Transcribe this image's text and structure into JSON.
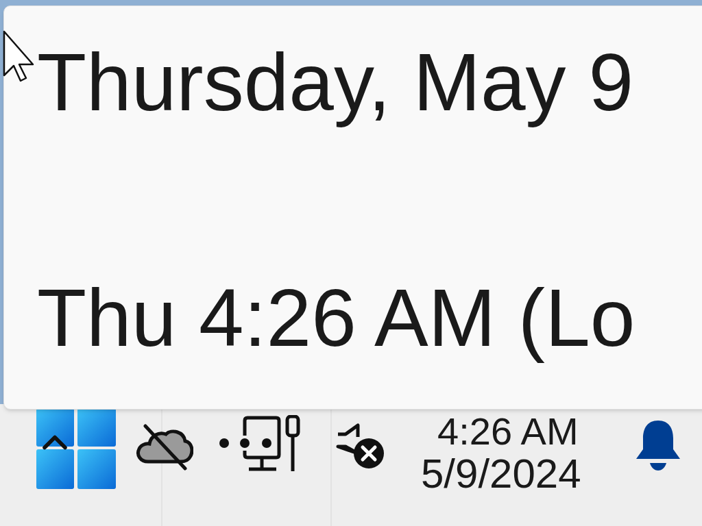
{
  "tooltip": {
    "lines": [
      "Thursday, May 9",
      "Thu 4:26 AM (Lo"
    ]
  },
  "taskbar": {
    "clock": {
      "time": "4:26 AM",
      "date": "5/9/2024"
    }
  }
}
